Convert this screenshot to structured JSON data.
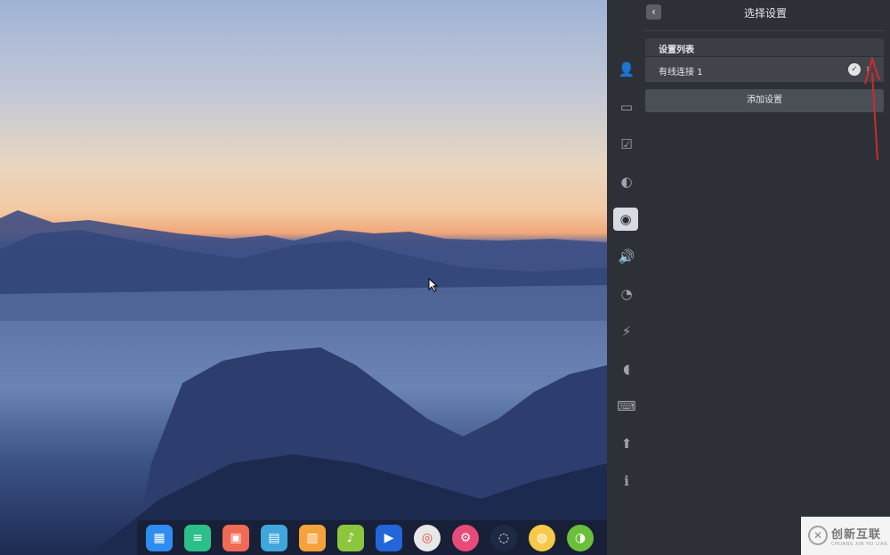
{
  "settings": {
    "header": {
      "title": "选择设置",
      "back_icon": "chevron-left-icon"
    },
    "list": {
      "title": "设置列表",
      "item_label": "有线连接 1",
      "status_icon": "check-icon",
      "open_icon": "chevron-right-icon"
    },
    "add_button_label": "添加设置",
    "sidebar": [
      {
        "name": "accounts-icon",
        "glyph": "👤"
      },
      {
        "name": "display-icon",
        "glyph": "▭"
      },
      {
        "name": "default-apps-icon",
        "glyph": "☑"
      },
      {
        "name": "personalization-icon",
        "glyph": "◐"
      },
      {
        "name": "network-icon",
        "glyph": "◉",
        "active": true
      },
      {
        "name": "sound-icon",
        "glyph": "🔊"
      },
      {
        "name": "time-icon",
        "glyph": "◔"
      },
      {
        "name": "power-icon",
        "glyph": "⚡"
      },
      {
        "name": "mouse-icon",
        "glyph": "◖"
      },
      {
        "name": "keyboard-icon",
        "glyph": "⌨"
      },
      {
        "name": "update-icon",
        "glyph": "⬆"
      },
      {
        "name": "info-icon",
        "glyph": "ℹ"
      }
    ]
  },
  "dock": [
    {
      "name": "launcher-icon",
      "color": "#2f8cf0",
      "glyph": "▦"
    },
    {
      "name": "file-manager-icon",
      "color": "#2bbf8a",
      "glyph": "≡"
    },
    {
      "name": "screen-recorder-icon",
      "color": "#f06a55",
      "glyph": "▣"
    },
    {
      "name": "archive-icon",
      "color": "#3fa7dc",
      "glyph": "▤"
    },
    {
      "name": "app-store-icon",
      "color": "#f5a23c",
      "glyph": "▥"
    },
    {
      "name": "music-icon",
      "color": "#8cc63f",
      "glyph": "♪"
    },
    {
      "name": "video-icon",
      "color": "#2266d9",
      "glyph": "▶"
    },
    {
      "name": "chrome-icon",
      "color": "#e8e8e8",
      "glyph": "◎"
    },
    {
      "name": "settings-icon",
      "color": "#e84a7a",
      "glyph": "⚙"
    },
    {
      "name": "deepin-icon",
      "color": "#1e2a44",
      "glyph": "◌"
    },
    {
      "name": "screenshot-icon",
      "color": "#f7c948",
      "glyph": "◍"
    },
    {
      "name": "extra-app-icon",
      "color": "#6bbf3a",
      "glyph": "◑"
    }
  ],
  "watermark": {
    "title": "创新互联",
    "subtitle": "CHUANG XIN HU LIAN"
  }
}
